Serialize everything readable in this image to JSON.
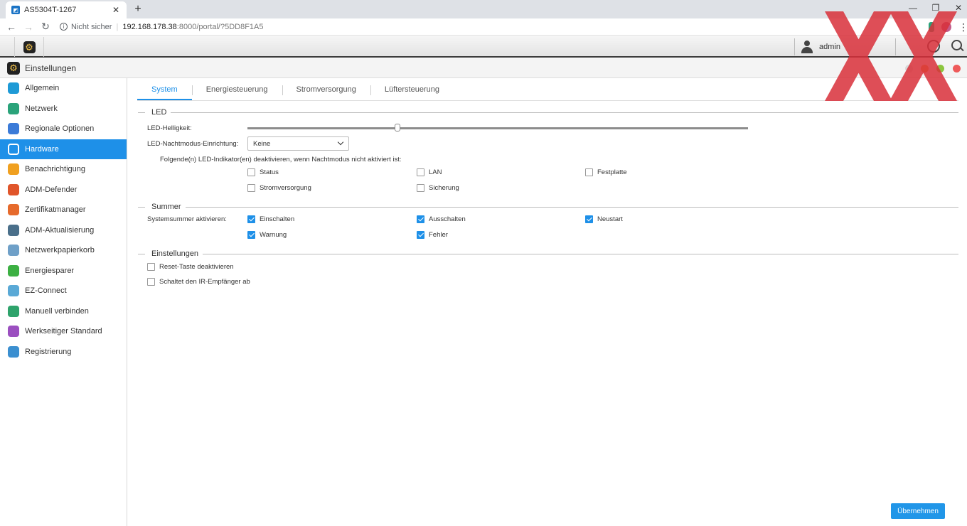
{
  "browser": {
    "tab_title": "AS5304T-1267",
    "new_tab": "+",
    "security": "Nicht sicher",
    "url_host": "192.168.178.38",
    "url_rest": ":8000/portal/?5DD8F1A5"
  },
  "topbar": {
    "username": "admin"
  },
  "window": {
    "title": "Einstellungen"
  },
  "sidebar": {
    "items": [
      {
        "label": "Allgemein",
        "icon": "settings-general-icon",
        "color": "#1e9ad6"
      },
      {
        "label": "Netzwerk",
        "icon": "globe-icon",
        "color": "#2aa37a"
      },
      {
        "label": "Regionale Optionen",
        "icon": "regional-icon",
        "color": "#3b7bd8"
      },
      {
        "label": "Hardware",
        "icon": "hardware-icon",
        "color": "#1e90e8",
        "active": true
      },
      {
        "label": "Benachrichtigung",
        "icon": "notification-icon",
        "color": "#f0a020"
      },
      {
        "label": "ADM-Defender",
        "icon": "defender-icon",
        "color": "#e0552a"
      },
      {
        "label": "Zertifikatmanager",
        "icon": "certificate-icon",
        "color": "#e66a2c"
      },
      {
        "label": "ADM-Aktualisierung",
        "icon": "update-icon",
        "color": "#4a6f8a"
      },
      {
        "label": "Netzwerkpapierkorb",
        "icon": "recycle-bin-icon",
        "color": "#6fa0c8"
      },
      {
        "label": "Energiesparer",
        "icon": "energy-saver-icon",
        "color": "#3cb043"
      },
      {
        "label": "EZ-Connect",
        "icon": "cloud-icon",
        "color": "#5aa9d6"
      },
      {
        "label": "Manuell verbinden",
        "icon": "connect-icon",
        "color": "#2ea36b"
      },
      {
        "label": "Werkseitiger Standard",
        "icon": "reset-icon",
        "color": "#9b4fc0"
      },
      {
        "label": "Registrierung",
        "icon": "registration-icon",
        "color": "#3b8fd0"
      }
    ]
  },
  "tabs": [
    "System",
    "Energiesteuerung",
    "Stromversorgung",
    "Lüftersteuerung"
  ],
  "led": {
    "section_title": "LED",
    "brightness_label": "LED-Helligkeit:",
    "brightness_value": 0.3,
    "night_mode_label": "LED-Nachtmodus-Einrichtung:",
    "night_mode_value": "Keine",
    "indicator_note": "Folgende(n) LED-Indikator(en) deaktivieren, wenn Nachtmodus nicht aktiviert ist:",
    "indicators": {
      "status": "Status",
      "lan": "LAN",
      "festplatte": "Festplatte",
      "stromversorgung": "Stromversorgung",
      "sicherung": "Sicherung"
    }
  },
  "summer": {
    "section_title": "Summer",
    "label": "Systemsummer aktivieren:",
    "options": {
      "einschalten": "Einschalten",
      "ausschalten": "Ausschalten",
      "neustart": "Neustart",
      "warnung": "Warnung",
      "fehler": "Fehler"
    }
  },
  "settings": {
    "section_title": "Einstellungen",
    "reset": "Reset-Taste deaktivieren",
    "ir": "Schaltet den IR-Empfänger ab"
  },
  "apply_button": "Übernehmen",
  "colors": {
    "accent": "#1e90e8",
    "watermark": "#d9303a"
  }
}
